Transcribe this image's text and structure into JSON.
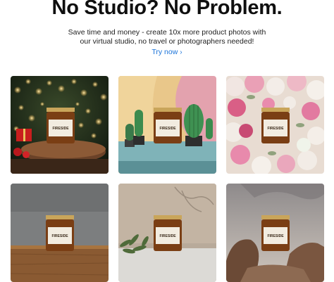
{
  "hero": {
    "headline": "No Studio? No Problem.",
    "subtext_line1": "Save time and money - create 10x more product photos with",
    "subtext_line2": "our virtual studio, no travel or photographers needed!",
    "cta_label": "Try now",
    "cta_icon": "chevron-right-icon",
    "cta_color": "#1a73d9"
  },
  "gallery": {
    "product_label": "FIRESIDE",
    "scenes": [
      {
        "name": "christmas-lights"
      },
      {
        "name": "cactus-pastel"
      },
      {
        "name": "roses-flowers"
      },
      {
        "name": "wood-table"
      },
      {
        "name": "leafy-plant"
      },
      {
        "name": "desert-rocks"
      }
    ]
  }
}
